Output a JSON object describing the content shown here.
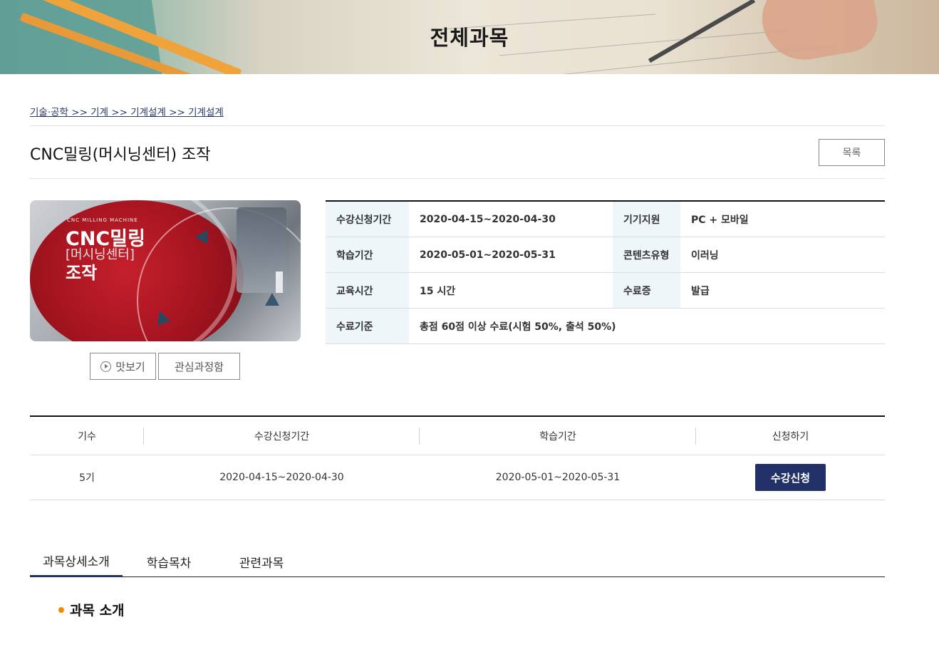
{
  "banner": {
    "title": "전체과목"
  },
  "breadcrumb": "기술·공학 >> 기계 >> 기계설계 >> 기계설계",
  "course": {
    "title": "CNC밀링(머시닝센터) 조작",
    "list_button": "목록",
    "thumbnail": {
      "subtitle": "CNC MILLING MACHINE",
      "line1": "CNC밀링",
      "line2": "[머시닝센터]",
      "line3": "조작"
    },
    "preview_button": "맛보기",
    "wishlist_button": "관심과정함"
  },
  "info": {
    "rows": [
      {
        "k1": "수강신청기간",
        "v1": "2020-04-15~2020-04-30",
        "k2": "기기지원",
        "v2": "PC + 모바일"
      },
      {
        "k1": "학습기간",
        "v1": "2020-05-01~2020-05-31",
        "k2": "콘텐츠유형",
        "v2": "이러닝"
      },
      {
        "k1": "교육시간",
        "v1": "15 시간",
        "k2": "수료증",
        "v2": "발급"
      },
      {
        "k1": "수료기준",
        "v1": "총점 60점 이상 수료(시험 50%, 출석 50%)"
      }
    ]
  },
  "schedule": {
    "headers": [
      "기수",
      "수강신청기간",
      "학습기간",
      "신청하기"
    ],
    "rows": [
      {
        "term": "5기",
        "apply_period": "2020-04-15~2020-04-30",
        "study_period": "2020-05-01~2020-05-31",
        "action": "수강신청"
      }
    ]
  },
  "tabs": [
    "과목상세소개",
    "학습목차",
    "관련과목"
  ],
  "section": {
    "title": "과목 소개"
  },
  "colors": {
    "navy": "#223068",
    "accent_orange": "#f08a00",
    "info_header_bg": "#eef6fa"
  }
}
